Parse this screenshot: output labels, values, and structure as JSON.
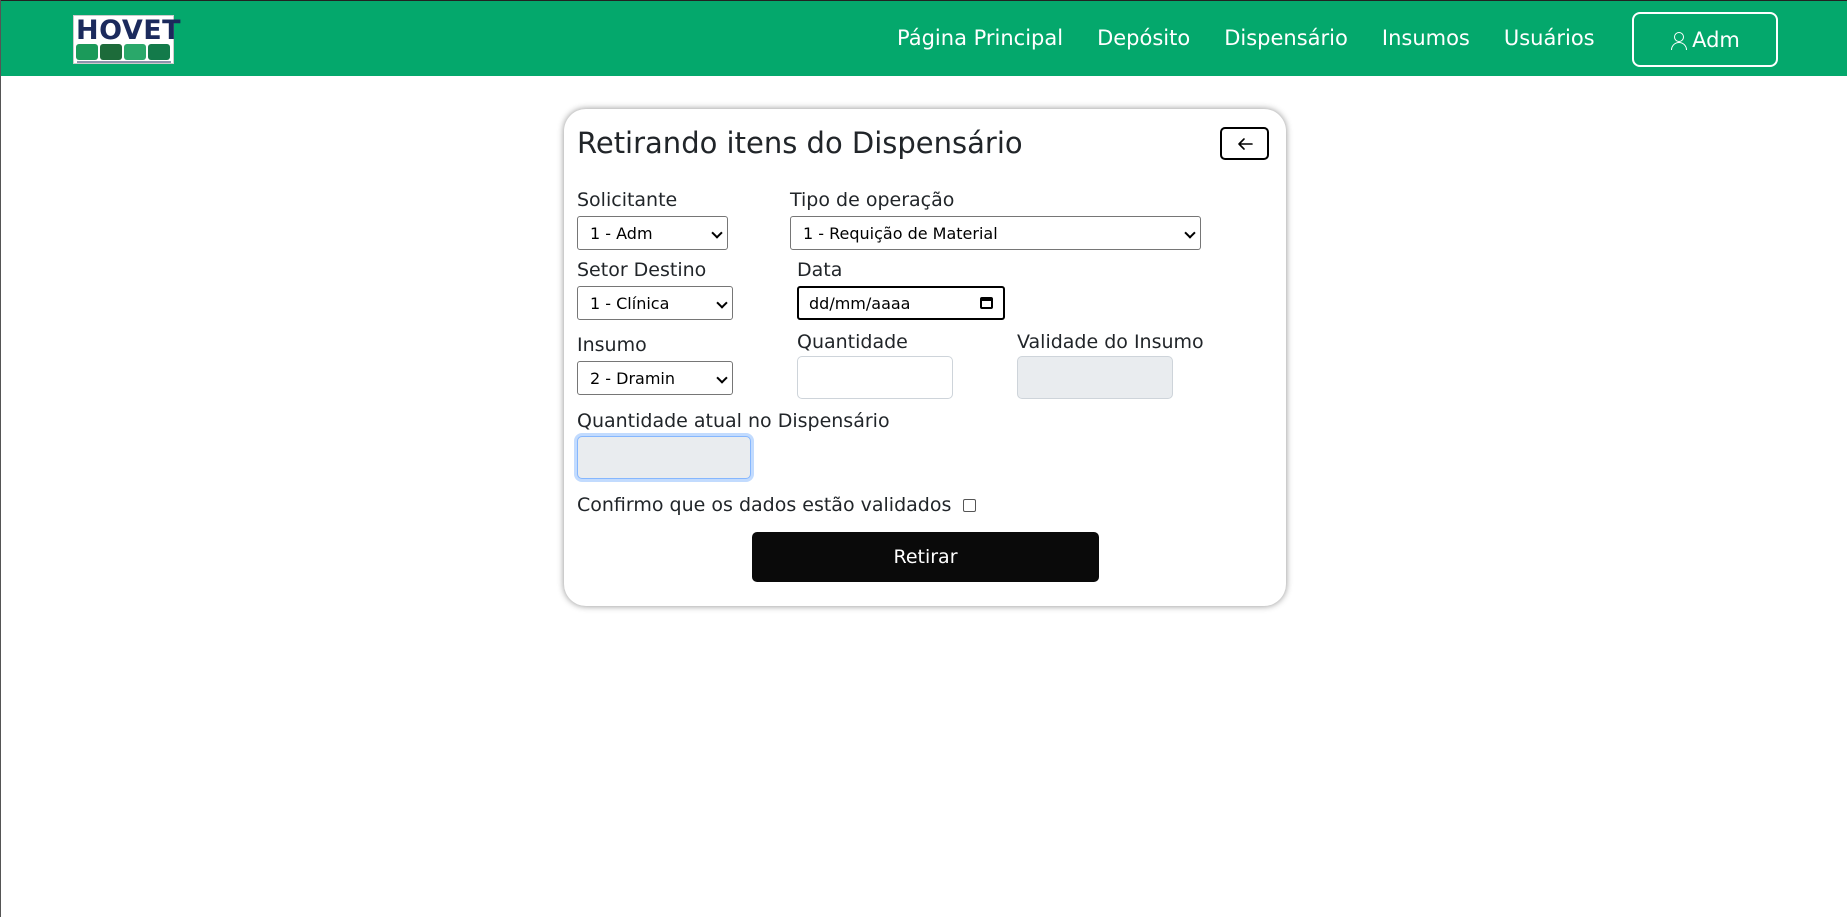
{
  "navbar": {
    "logo_text": "HOVET",
    "links": [
      "Página Principal",
      "Depósito",
      "Dispensário",
      "Insumos",
      "Usuários"
    ],
    "user_label": "Adm"
  },
  "form": {
    "title": "Retirando itens do Dispensário",
    "solicitante": {
      "label": "Solicitante",
      "value": "1 - Adm"
    },
    "tipo_operacao": {
      "label": "Tipo de operação",
      "value": "1 - Requição de Material"
    },
    "setor_destino": {
      "label": "Setor Destino",
      "value": "1 - Clínica"
    },
    "data": {
      "label": "Data",
      "placeholder": "dd/mm/aaaa"
    },
    "insumo": {
      "label": "Insumo",
      "value": "2 - Dramin"
    },
    "quantidade": {
      "label": "Quantidade",
      "value": ""
    },
    "validade": {
      "label": "Validade do Insumo",
      "value": ""
    },
    "quantidade_atual": {
      "label": "Quantidade atual no Dispensário",
      "value": ""
    },
    "confirm_label": "Confirmo que os dados estão validados",
    "submit_label": "Retirar"
  },
  "colors": {
    "navbar": "#04a86c",
    "button": "#0a0a0a"
  }
}
